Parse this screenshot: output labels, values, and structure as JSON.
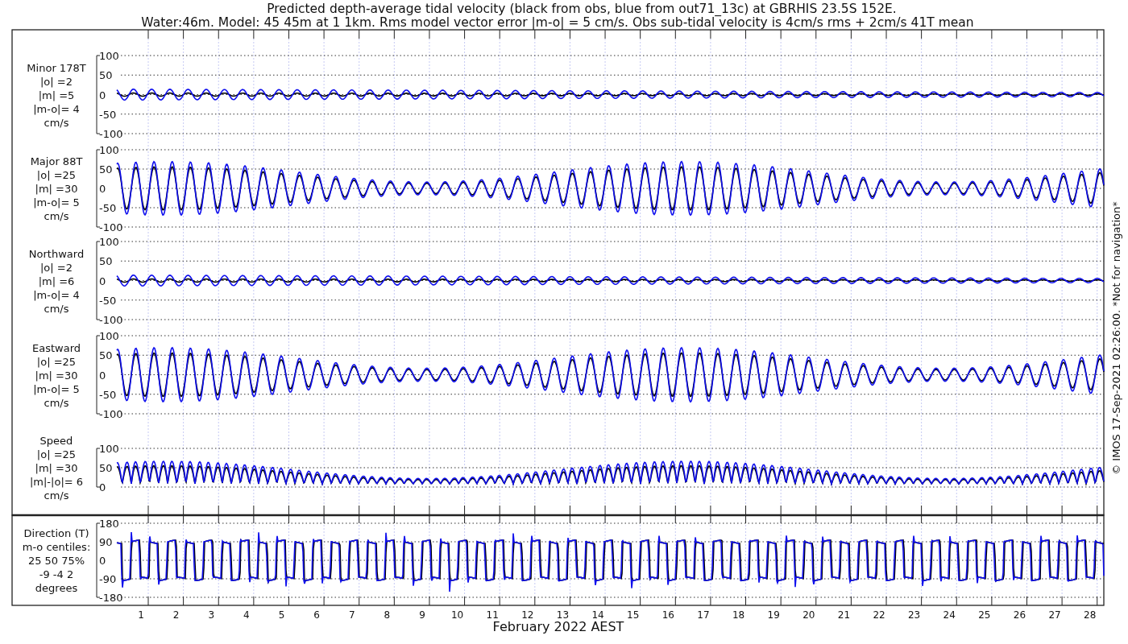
{
  "title": {
    "line_1": "Predicted depth-average tidal velocity (black from obs, blue from out71_13c) at GBRHIS 23.5S 152E.",
    "line_2": "Water:46m. Model: 45 45m at 1 1km. Rms model vector error |m-o| = 5 cm/s. Obs sub-tidal velocity is 4cm/s rms + 2cm/s 41T mean"
  },
  "panels": [
    {
      "kind": "minor",
      "label_lines": [
        "Minor 178T",
        "|o| =2",
        "|m| =5",
        "|m-o|= 4",
        "cm/s"
      ],
      "yticks": [
        "100",
        "50",
        "0",
        "-50",
        "-100"
      ]
    },
    {
      "kind": "major",
      "label_lines": [
        "Major 88T",
        "|o| =25",
        "|m| =30",
        "|m-o|= 5",
        "cm/s"
      ],
      "yticks": [
        "100",
        "50",
        "0",
        "-50",
        "-100"
      ]
    },
    {
      "kind": "northward",
      "label_lines": [
        "Northward",
        "|o| =2",
        "|m| =6",
        "|m-o|= 4",
        "cm/s"
      ],
      "yticks": [
        "100",
        "50",
        "0",
        "-50",
        "-100"
      ]
    },
    {
      "kind": "eastward",
      "label_lines": [
        "Eastward",
        "|o| =25",
        "|m| =30",
        "|m-o|= 5",
        "cm/s"
      ],
      "yticks": [
        "100",
        "50",
        "0",
        "-50",
        "-100"
      ]
    },
    {
      "kind": "speed",
      "label_lines": [
        "Speed",
        "|o| =25",
        "|m| =30",
        "|m|-|o|= 6",
        "cm/s"
      ],
      "yticks": [
        "100",
        "50",
        "0"
      ]
    },
    {
      "kind": "direction",
      "label_lines": [
        "Direction (T)",
        "m-o centiles:",
        "25  50  75%",
        "-9 -4  2",
        "degrees"
      ],
      "yticks": [
        "180",
        "90",
        "0",
        "-90",
        "-180"
      ]
    }
  ],
  "x_axis": {
    "ticks": [
      "1",
      "2",
      "3",
      "4",
      "5",
      "6",
      "7",
      "8",
      "9",
      "10",
      "11",
      "12",
      "13",
      "14",
      "15",
      "16",
      "17",
      "18",
      "19",
      "20",
      "21",
      "22",
      "23",
      "24",
      "25",
      "26",
      "27",
      "28"
    ],
    "label": "February 2022 AEST"
  },
  "footer_note": "© IMOS 17-Sep-2021 02:26:00. *Not for navigation*"
}
